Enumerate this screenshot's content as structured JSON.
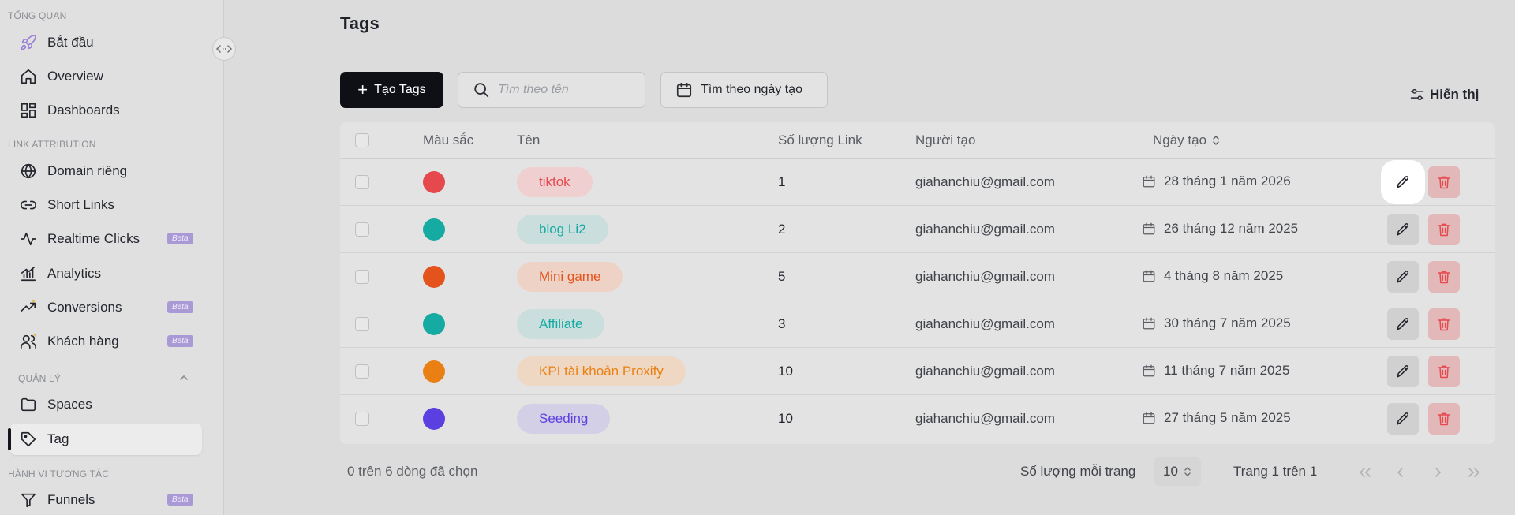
{
  "sidebar": {
    "sections": [
      {
        "label": "TỔNG QUAN"
      },
      {
        "label": "LINK ATTRIBUTION"
      },
      {
        "label": "QUẢN LÝ"
      },
      {
        "label": "HÀNH VI TƯƠNG TÁC"
      }
    ],
    "items": [
      {
        "label": "Bắt đầu",
        "icon": "rocket-icon"
      },
      {
        "label": "Overview",
        "icon": "home-icon"
      },
      {
        "label": "Dashboards",
        "icon": "dashboard-icon"
      },
      {
        "label": "Domain riêng",
        "icon": "globe-icon"
      },
      {
        "label": "Short Links",
        "icon": "link-icon"
      },
      {
        "label": "Realtime Clicks",
        "icon": "activity-icon",
        "badge": "Beta"
      },
      {
        "label": "Analytics",
        "icon": "analytics-icon"
      },
      {
        "label": "Conversions",
        "icon": "trend-icon",
        "badge": "Beta"
      },
      {
        "label": "Khách hàng",
        "icon": "users-icon",
        "badge": "Beta"
      },
      {
        "label": "Spaces",
        "icon": "folder-icon"
      },
      {
        "label": "Tag",
        "icon": "tag-icon",
        "active": true
      },
      {
        "label": "Funnels",
        "icon": "funnel-icon",
        "badge": "Beta"
      }
    ]
  },
  "header": {
    "title": "Tags"
  },
  "toolbar": {
    "create_label": "Tạo Tags",
    "search_placeholder": "Tìm theo tên",
    "date_filter_label": "Tìm theo ngày tạo",
    "display_label": "Hiển thị"
  },
  "table": {
    "columns": [
      "Màu sắc",
      "Tên",
      "Số lượng Link",
      "Người tạo",
      "Ngày tạo"
    ],
    "rows": [
      {
        "color": "#e5484d",
        "name": "tiktok",
        "pill_bg": "#efcfd0",
        "pill_fg": "#e5484d",
        "count": "1",
        "creator": "giahanchiu@gmail.com",
        "date": "28 tháng 1 năm 2026"
      },
      {
        "color": "#15aba3",
        "name": "blog Li2",
        "pill_bg": "#c9dedd",
        "pill_fg": "#15aba3",
        "count": "2",
        "creator": "giahanchiu@gmail.com",
        "date": "26 tháng 12 năm 2025"
      },
      {
        "color": "#e5531c",
        "name": "Mini game",
        "pill_bg": "#efd2c6",
        "pill_fg": "#e5531c",
        "count": "5",
        "creator": "giahanchiu@gmail.com",
        "date": "4 tháng 8 năm 2025"
      },
      {
        "color": "#15aba3",
        "name": "Affiliate",
        "pill_bg": "#c9dedd",
        "pill_fg": "#15aba3",
        "count": "3",
        "creator": "giahanchiu@gmail.com",
        "date": "30 tháng 7 năm 2025"
      },
      {
        "color": "#ea8014",
        "name": "KPI tài khoản Proxify",
        "pill_bg": "#efd8c3",
        "pill_fg": "#ea8014",
        "count": "10",
        "creator": "giahanchiu@gmail.com",
        "date": "11 tháng 7 năm 2025"
      },
      {
        "color": "#5b3fe0",
        "name": "Seeding",
        "pill_bg": "#d3cfe6",
        "pill_fg": "#5b3fe0",
        "count": "10",
        "creator": "giahanchiu@gmail.com",
        "date": "27 tháng 5 năm 2025"
      }
    ]
  },
  "footer": {
    "selection_text": "0 trên 6 dòng đã chọn",
    "per_page_label": "Số lượng mỗi trang",
    "per_page_value": "10",
    "page_info": "Trang 1 trên 1"
  }
}
